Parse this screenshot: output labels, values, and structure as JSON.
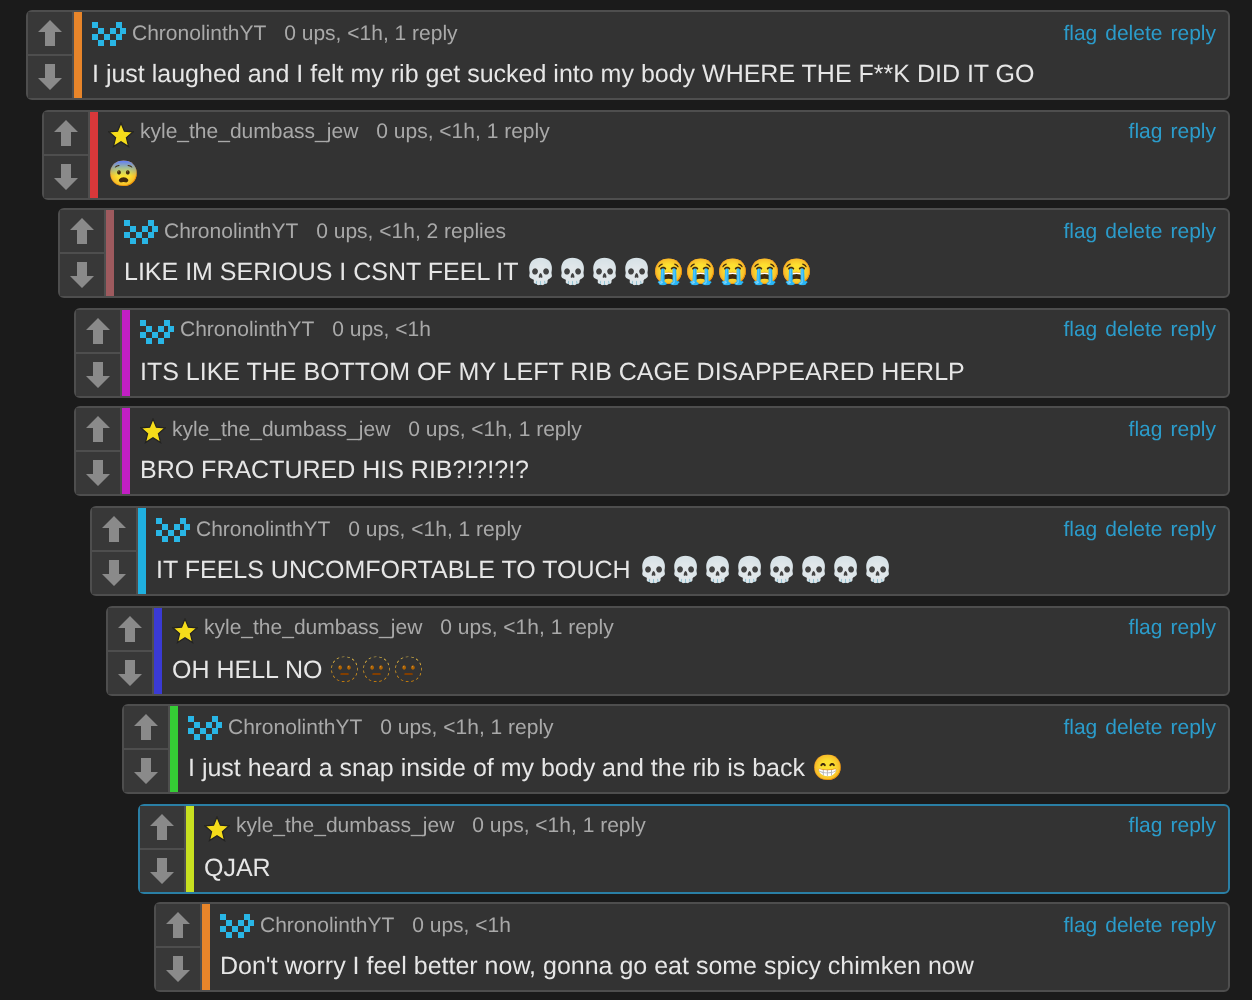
{
  "comments": [
    {
      "author": "ChronolinthYT",
      "kind": "pixel",
      "meta": "0 ups, <1h, 1 reply",
      "actions": [
        "flag",
        "delete",
        "reply"
      ],
      "text": "I just laughed and I felt my rib get sucked into my body WHERE THE F**K DID IT GO",
      "color": "#e8852a",
      "highlighted": false,
      "children": [
        {
          "author": "kyle_the_dumbass_jew",
          "kind": "star",
          "meta": "0 ups, <1h, 1 reply",
          "actions": [
            "flag",
            "reply"
          ],
          "text": "😨",
          "color": "#d9383a",
          "highlighted": false,
          "children": [
            {
              "author": "ChronolinthYT",
              "kind": "pixel",
              "meta": "0 ups, <1h, 2 replies",
              "actions": [
                "flag",
                "delete",
                "reply"
              ],
              "text": "LIKE IM SERIOUS I CSNT FEEL IT 💀💀💀💀😭😭😭😭😭",
              "color": "#9e5a5e",
              "highlighted": false,
              "children": [
                {
                  "author": "ChronolinthYT",
                  "kind": "pixel",
                  "meta": "0 ups, <1h",
                  "actions": [
                    "flag",
                    "delete",
                    "reply"
                  ],
                  "text": "ITS LIKE THE BOTTOM OF MY LEFT RIB CAGE DISAPPEARED HERLP",
                  "color": "#c21fc4",
                  "highlighted": false
                },
                {
                  "author": "kyle_the_dumbass_jew",
                  "kind": "star",
                  "meta": "0 ups, <1h, 1 reply",
                  "actions": [
                    "flag",
                    "reply"
                  ],
                  "text": "BRO FRACTURED HIS RIB?!?!?!?",
                  "color": "#c21fc4",
                  "highlighted": false,
                  "children": [
                    {
                      "author": "ChronolinthYT",
                      "kind": "pixel",
                      "meta": "0 ups, <1h, 1 reply",
                      "actions": [
                        "flag",
                        "delete",
                        "reply"
                      ],
                      "text": "IT FEELS UNCOMFORTABLE TO TOUCH 💀💀💀💀💀💀💀💀",
                      "color": "#1fb0e0",
                      "highlighted": false,
                      "children": [
                        {
                          "author": "kyle_the_dumbass_jew",
                          "kind": "star",
                          "meta": "0 ups, <1h, 1 reply",
                          "actions": [
                            "flag",
                            "reply"
                          ],
                          "text": "OH HELL NO 🫥🫥🫥",
                          "color": "#3a3ad4",
                          "highlighted": false,
                          "children": [
                            {
                              "author": "ChronolinthYT",
                              "kind": "pixel",
                              "meta": "0 ups, <1h, 1 reply",
                              "actions": [
                                "flag",
                                "delete",
                                "reply"
                              ],
                              "text": "I just heard a snap inside of my body and the rib is back 😁",
                              "color": "#35cc35",
                              "highlighted": false,
                              "children": [
                                {
                                  "author": "kyle_the_dumbass_jew",
                                  "kind": "star",
                                  "meta": "0 ups, <1h, 1 reply",
                                  "actions": [
                                    "flag",
                                    "reply"
                                  ],
                                  "text": "QJAR",
                                  "color": "#c8e020",
                                  "highlighted": true,
                                  "children": [
                                    {
                                      "author": "ChronolinthYT",
                                      "kind": "pixel",
                                      "meta": "0 ups, <1h",
                                      "actions": [
                                        "flag",
                                        "delete",
                                        "reply"
                                      ],
                                      "text": "Don't worry I feel better now, gonna go eat some spicy chimken now",
                                      "color": "#e8852a",
                                      "highlighted": false
                                    }
                                  ]
                                }
                              ]
                            }
                          ]
                        }
                      ]
                    }
                  ]
                }
              ]
            }
          ]
        }
      ]
    }
  ]
}
